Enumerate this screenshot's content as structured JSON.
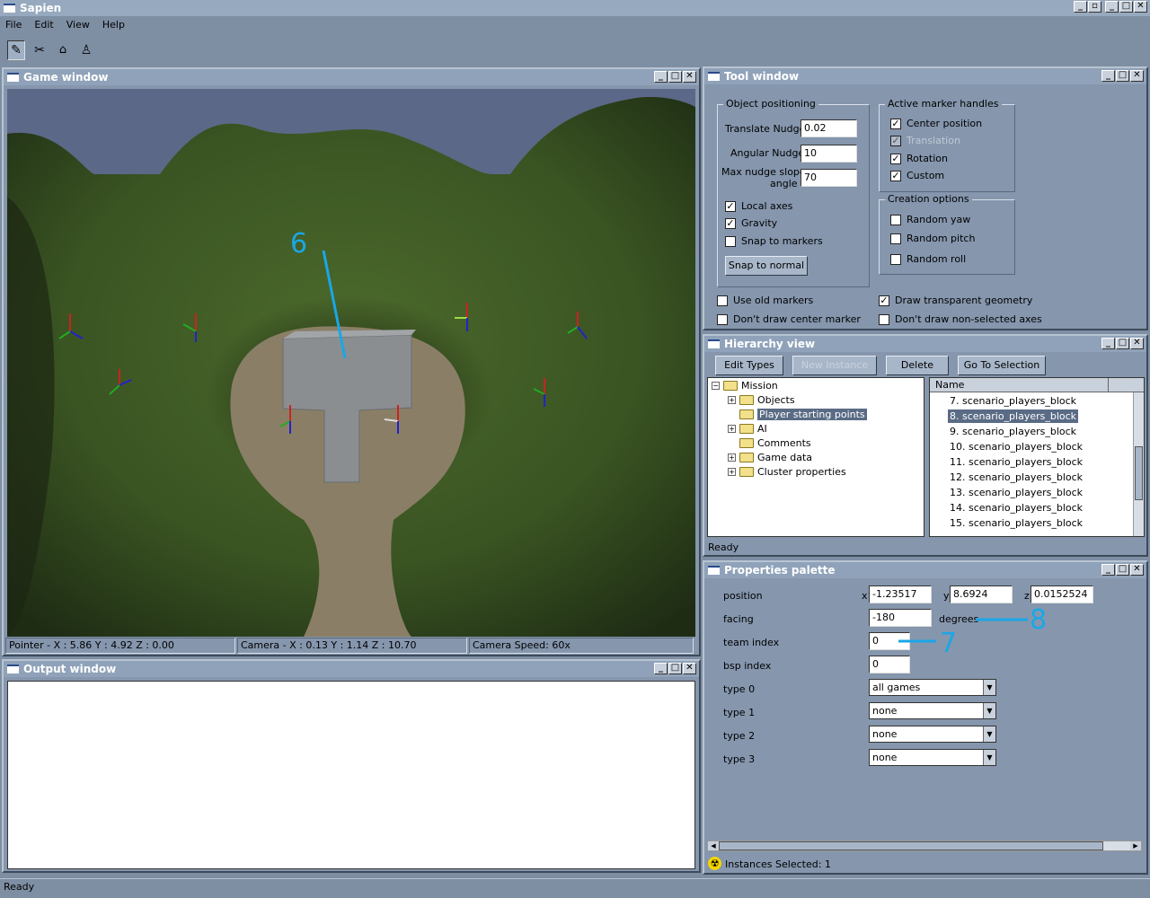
{
  "app": {
    "title": "Sapien"
  },
  "menu": [
    "File",
    "Edit",
    "View",
    "Help"
  ],
  "toolbar": {
    "tools": [
      "pencil-icon",
      "splitter-icon",
      "camera-icon",
      "figure-icon"
    ]
  },
  "game_window": {
    "title": "Game window",
    "annotation": "6",
    "status": {
      "pointer": "Pointer - X : 5.86  Y : 4.92  Z : 0.00",
      "camera": "Camera - X : 0.13  Y : 1.14  Z : 10.70",
      "speed": "Camera Speed: 60x"
    }
  },
  "output_window": {
    "title": "Output window"
  },
  "tool_window": {
    "title": "Tool window",
    "object_positioning": {
      "label": "Object positioning",
      "translate_nudge_label": "Translate Nudge",
      "translate_nudge": "0.02",
      "angular_nudge_label": "Angular Nudge",
      "angular_nudge": "10",
      "max_slope_label_1": "Max nudge slope",
      "max_slope_label_2": "angle",
      "max_slope": "70",
      "local_axes": "Local axes",
      "gravity": "Gravity",
      "snap_to_markers": "Snap to markers",
      "snap_to_normal": "Snap to normal"
    },
    "active_marker_handles": {
      "label": "Active marker handles",
      "center_position": "Center position",
      "translation": "Translation",
      "rotation": "Rotation",
      "custom": "Custom"
    },
    "creation_options": {
      "label": "Creation options",
      "random_yaw": "Random yaw",
      "random_pitch": "Random pitch",
      "random_roll": "Random roll"
    },
    "use_old_markers": "Use old markers",
    "dont_draw_center_marker": "Don't draw center marker",
    "draw_transparent_geometry": "Draw transparent geometry",
    "dont_draw_non_selected_axes": "Don't draw non-selected axes"
  },
  "hierarchy_view": {
    "title": "Hierarchy view",
    "buttons": {
      "edit_types": "Edit Types",
      "new_instance": "New Instance",
      "delete": "Delete",
      "go_to_selection": "Go To Selection"
    },
    "tree": {
      "root": "Mission",
      "children": [
        "Objects",
        "Player starting points",
        "AI",
        "Comments",
        "Game data",
        "Cluster properties"
      ]
    },
    "list_header": "Name",
    "list": [
      "7. scenario_players_block",
      "8. scenario_players_block",
      "9. scenario_players_block",
      "10. scenario_players_block",
      "11. scenario_players_block",
      "12. scenario_players_block",
      "13. scenario_players_block",
      "14. scenario_players_block",
      "15. scenario_players_block"
    ],
    "status": "Ready"
  },
  "properties_palette": {
    "title": "Properties palette",
    "position_label": "position",
    "x_label": "x",
    "x": "-1.23517",
    "y_label": "y",
    "y": "8.6924",
    "z_label": "z",
    "z": "0.0152524",
    "facing_label": "facing",
    "facing": "-180",
    "facing_unit": "degrees",
    "team_index_label": "team index",
    "team_index": "0",
    "bsp_index_label": "bsp index",
    "bsp_index": "0",
    "type0_label": "type 0",
    "type0": "all games",
    "type1_label": "type 1",
    "type1": "none",
    "type2_label": "type 2",
    "type2": "none",
    "type3_label": "type 3",
    "type3": "none",
    "annotation_7": "7",
    "annotation_8": "8",
    "status": "Instances Selected: 1"
  },
  "status_bar": "Ready"
}
